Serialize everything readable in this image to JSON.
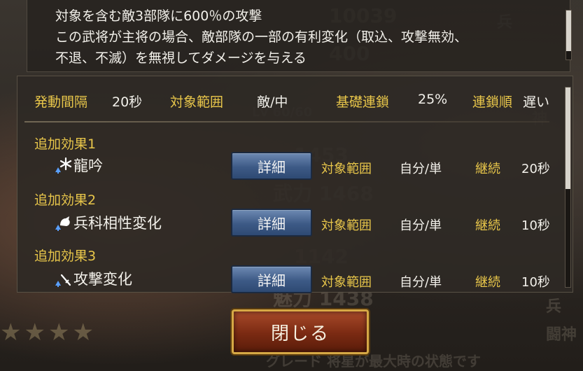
{
  "description": {
    "lines": [
      "対象を含む敵3部隊に600％の攻撃",
      "この武将が主将の場合、敵部隊の一部の有利変化（取込、攻撃無効、",
      "不退、不滅）を無視してダメージを与える"
    ]
  },
  "stats": {
    "interval_label": "発動間隔",
    "interval_value": "20秒",
    "range_label": "対象範囲",
    "range_value": "敵/中",
    "chain_label": "基礎連鎖",
    "chain_value": "25%",
    "order_label": "連鎖順",
    "order_value": "遅い"
  },
  "effects": [
    {
      "title": "追加効果1",
      "name": "龍吟",
      "icon": "dragon-roar-icon",
      "detail_label": "詳細",
      "range_label": "対象範囲",
      "range_value": "自分/単",
      "duration_label": "継続",
      "duration_value": "20秒"
    },
    {
      "title": "追加効果2",
      "name": "兵科相性変化",
      "icon": "arm-affinity-icon",
      "detail_label": "詳細",
      "range_label": "対象範囲",
      "range_value": "自分/単",
      "duration_label": "継続",
      "duration_value": "10秒"
    },
    {
      "title": "追加効果3",
      "name": "攻撃変化",
      "icon": "sword-attack-icon",
      "detail_label": "詳細",
      "range_label": "対象範囲",
      "range_value": "自分/単",
      "duration_label": "継続",
      "duration_value": "10秒"
    }
  ],
  "close_label": "閉じる",
  "colors": {
    "gold": "#e8c64a",
    "detail_button": "#3d5a86",
    "close_button": "#7a2a12"
  }
}
